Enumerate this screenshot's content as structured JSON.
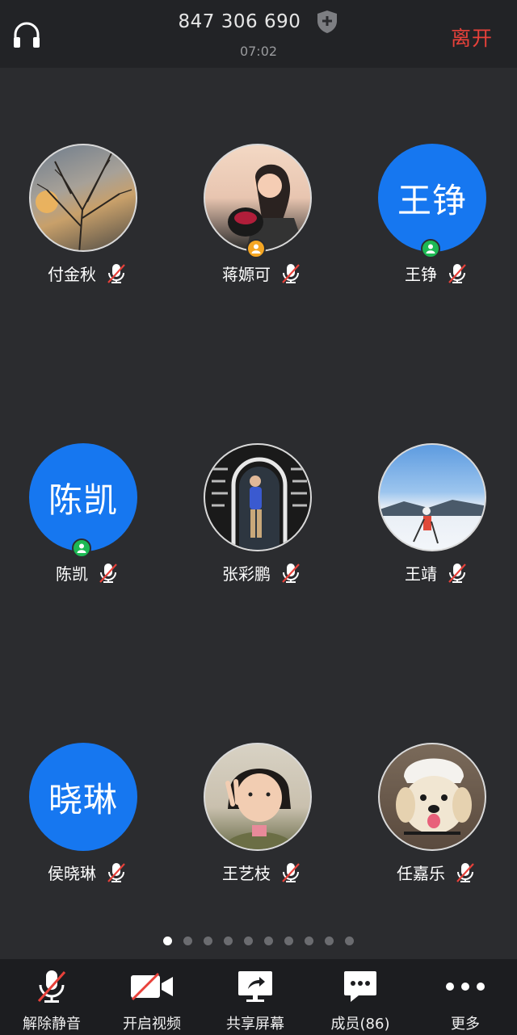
{
  "header": {
    "meeting_id": "847 306 690",
    "timer": "07:02",
    "leave_label": "离开"
  },
  "participants": [
    {
      "name": "付金秋",
      "avatar_type": "photo",
      "avatar_desc": "bare-trees-sunset",
      "muted": true
    },
    {
      "name": "蒋嫄可",
      "avatar_type": "photo",
      "avatar_desc": "girl-with-dog",
      "muted": true,
      "badge": "host"
    },
    {
      "name": "王铮",
      "avatar_type": "text",
      "avatar_text": "王铮",
      "muted": true,
      "badge": "cohost"
    },
    {
      "name": "陈凯",
      "avatar_type": "text",
      "avatar_text": "陈凯",
      "muted": true,
      "badge": "cohost"
    },
    {
      "name": "张彩鹏",
      "avatar_type": "photo",
      "avatar_desc": "person-in-neon-arch",
      "muted": true
    },
    {
      "name": "王靖",
      "avatar_type": "photo",
      "avatar_desc": "skier-on-snow",
      "muted": true
    },
    {
      "name": "侯晓琳",
      "avatar_type": "text",
      "avatar_text": "晓琳",
      "muted": true
    },
    {
      "name": "王艺枝",
      "avatar_type": "photo",
      "avatar_desc": "child-peace-sign",
      "muted": true
    },
    {
      "name": "任嘉乐",
      "avatar_type": "photo",
      "avatar_desc": "puppy-with-helmet",
      "muted": true
    }
  ],
  "pagination": {
    "total": 10,
    "active": 1
  },
  "toolbar": {
    "unmute_label": "解除静音",
    "video_label": "开启视频",
    "share_label": "共享屏幕",
    "members_label": "成员(86)",
    "more_label": "更多"
  },
  "colors": {
    "background": "#2b2c2f",
    "topbar": "#222326",
    "bottombar": "#1c1d20",
    "leave": "#e8413a",
    "avatar_blue": "#1677f0",
    "muted_slash": "#e8413a",
    "host_badge": "#f5a623",
    "cohost_badge": "#1db954"
  }
}
